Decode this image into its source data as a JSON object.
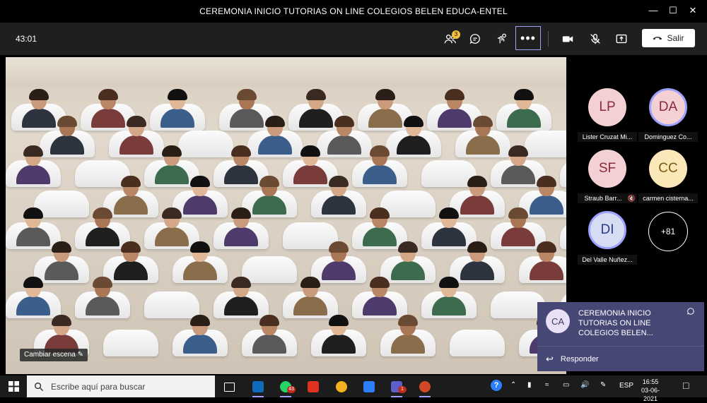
{
  "window": {
    "title": "CEREMONIA INICIO TUTORIAS ON LINE COLEGIOS BELEN EDUCA-ENTEL"
  },
  "toolbar": {
    "timer": "43:01",
    "participants_badge": "3",
    "more_label": "•••",
    "leave_label": "Salir"
  },
  "stage": {
    "scene_button_label": "Cambiar escena"
  },
  "participants": [
    {
      "initials": "LP",
      "name": "Lister Cruzat Mi...",
      "bg": "#f3d0d4",
      "fg": "#8a2a3a",
      "ring": false,
      "muted": false
    },
    {
      "initials": "DA",
      "name": "Dominguez Co...",
      "bg": "#f3d0d4",
      "fg": "#8a2a3a",
      "ring": true,
      "muted": false
    },
    {
      "initials": "SF",
      "name": "Straub Barr...",
      "bg": "#f3d0d4",
      "fg": "#8a2a3a",
      "ring": false,
      "muted": true
    },
    {
      "initials": "CC",
      "name": "carmen cisterna...",
      "bg": "#fbe8b8",
      "fg": "#7a5a10",
      "ring": false,
      "muted": false
    },
    {
      "initials": "DI",
      "name": "Del Valle Nuñez...",
      "bg": "#d6ddf3",
      "fg": "#2c3e8a",
      "ring": true,
      "muted": false
    }
  ],
  "overflow_count": "+81",
  "toast": {
    "initials": "CA",
    "message": "CEREMONIA INICIO TUTORIAS ON LINE COLEGIOS BELEN...",
    "reply_label": "Responder"
  },
  "taskbar": {
    "search_placeholder": "Escribe aquí para buscar",
    "apps": [
      {
        "name": "task-view",
        "color": "#1c1c1c",
        "badge": ""
      },
      {
        "name": "outlook",
        "color": "#0f6cbd",
        "badge": ""
      },
      {
        "name": "whatsapp",
        "color": "#25d366",
        "badge": "43"
      },
      {
        "name": "acrobat",
        "color": "#e0321e",
        "badge": ""
      },
      {
        "name": "chrome",
        "color": "#f2b01e",
        "badge": ""
      },
      {
        "name": "power-automate",
        "color": "#2d7ff9",
        "badge": ""
      },
      {
        "name": "teams",
        "color": "#5b5fc7",
        "badge": "1"
      },
      {
        "name": "powerpoint",
        "color": "#d24726",
        "badge": ""
      }
    ],
    "language": "ESP",
    "time": "16:55",
    "date": "03-06-2021"
  },
  "colors": {
    "accent": "#5b5fc7",
    "toast_bg": "#464775"
  }
}
